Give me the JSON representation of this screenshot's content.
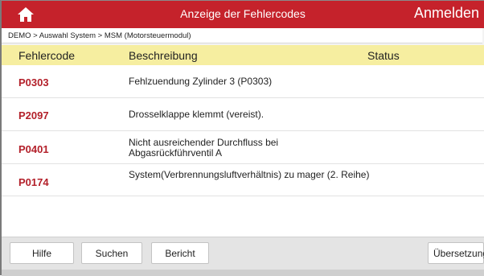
{
  "header": {
    "title": "Anzeige der Fehlercodes",
    "login_label": "Anmelden",
    "background_color": "#c5222b",
    "home_icon": "home-icon"
  },
  "breadcrumb": "DEMO > Auswahl System > MSM (Motorsteuermodul)",
  "table": {
    "header_background": "#f6eea0",
    "columns": [
      "Fehlercode",
      "Beschreibung",
      "Status"
    ],
    "rows": [
      {
        "code": "P0303",
        "description": "Fehlzuendung Zylinder 3 (P0303)",
        "status": ""
      },
      {
        "code": "P2097",
        "description": "Drosselklappe klemmt (vereist).",
        "status": ""
      },
      {
        "code": "P0401",
        "description": "Nicht ausreichender Durchfluss bei Abgasrückführventil A",
        "status": ""
      },
      {
        "code": "P0174",
        "description": "System(Verbrennungsluftverhältnis) zu mager (2. Reihe)",
        "status": ""
      }
    ],
    "code_color": "#b3202a"
  },
  "footer": {
    "help_label": "Hilfe",
    "search_label": "Suchen",
    "report_label": "Bericht",
    "translate_label": "Übersetzung"
  }
}
